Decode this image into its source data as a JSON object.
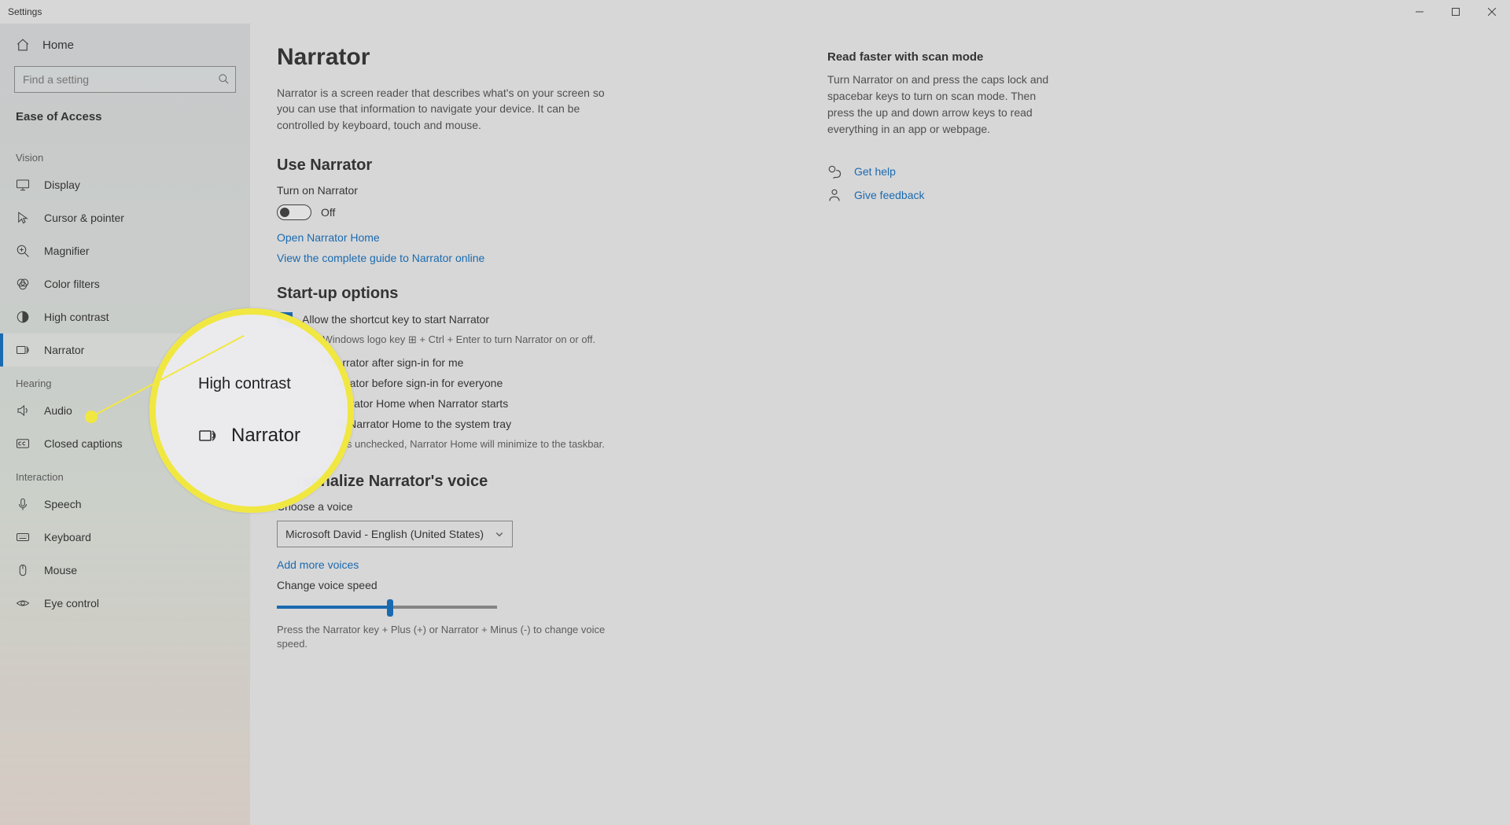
{
  "titlebar": {
    "app": "Settings"
  },
  "sidebar": {
    "home": "Home",
    "search_placeholder": "Find a setting",
    "category": "Ease of Access",
    "groups": [
      {
        "label": "Vision",
        "items": [
          {
            "icon": "display",
            "label": "Display"
          },
          {
            "icon": "cursor",
            "label": "Cursor & pointer"
          },
          {
            "icon": "magnifier",
            "label": "Magnifier"
          },
          {
            "icon": "colorfilters",
            "label": "Color filters"
          },
          {
            "icon": "highcontrast",
            "label": "High contrast"
          },
          {
            "icon": "narrator",
            "label": "Narrator",
            "selected": true
          }
        ]
      },
      {
        "label": "Hearing",
        "items": [
          {
            "icon": "audio",
            "label": "Audio"
          },
          {
            "icon": "cc",
            "label": "Closed captions"
          }
        ]
      },
      {
        "label": "Interaction",
        "items": [
          {
            "icon": "speech",
            "label": "Speech"
          },
          {
            "icon": "keyboard",
            "label": "Keyboard"
          },
          {
            "icon": "mouse",
            "label": "Mouse"
          },
          {
            "icon": "eye",
            "label": "Eye control"
          }
        ]
      }
    ]
  },
  "page": {
    "title": "Narrator",
    "description": "Narrator is a screen reader that describes what's on your screen so you can use that information to navigate your device. It can be controlled by keyboard, touch and mouse."
  },
  "use": {
    "heading": "Use Narrator",
    "toggle_label": "Turn on Narrator",
    "toggle_state": "Off",
    "link_home": "Open Narrator Home",
    "link_guide": "View the complete guide to Narrator online"
  },
  "startup": {
    "heading": "Start-up options",
    "cb1": "Allow the shortcut key to start Narrator",
    "cb1_hint": "Press the Windows logo key ⊞ + Ctrl + Enter to turn Narrator on or off.",
    "cb2": "Start Narrator after sign-in for me",
    "cb3": "Start Narrator before sign-in for everyone",
    "cb4": "Show Narrator Home when Narrator starts",
    "cb5": "Minimize Narrator Home to the system tray",
    "cb5_hint": "When this box is unchecked, Narrator Home will minimize to the taskbar."
  },
  "voice": {
    "heading": "Personalize Narrator's voice",
    "choose_label": "Choose a voice",
    "selected": "Microsoft David - English (United States)",
    "add_link": "Add more voices",
    "speed_label": "Change voice speed",
    "speed_hint": "Press the Narrator key + Plus (+) or Narrator + Minus (-) to change voice speed."
  },
  "right": {
    "tip_title": "Read faster with scan mode",
    "tip_body": "Turn Narrator on and press the caps lock and spacebar keys to turn on scan mode. Then press the up and down arrow keys to read everything in an app or webpage.",
    "help": "Get help",
    "feedback": "Give feedback"
  },
  "annotation": {
    "row1": "High contrast",
    "row2": "Narrator"
  }
}
